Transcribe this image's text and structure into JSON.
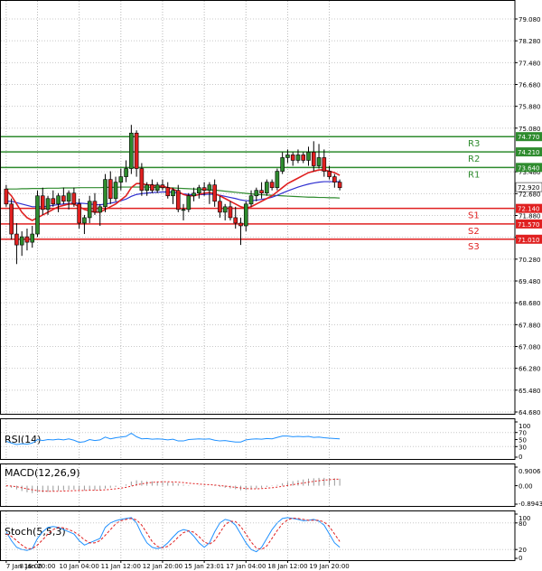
{
  "chart_data": {
    "type": "candlestick",
    "price_panel": {
      "ylim": [
        64.68,
        79.08
      ],
      "y_ticks": [
        "79.080",
        "78.280",
        "77.480",
        "76.680",
        "75.880",
        "75.080",
        "73.480",
        "72.680",
        "71.880",
        "71.080",
        "70.280",
        "69.480",
        "68.680",
        "67.880",
        "67.080",
        "66.280",
        "65.480",
        "64.680"
      ],
      "current_price": 72.92,
      "current_price_label": "72.920",
      "levels": [
        {
          "name": "R3",
          "value": 74.77,
          "label": "74.770",
          "color": "#2e8b2e"
        },
        {
          "name": "R2",
          "value": 74.21,
          "label": "74.210",
          "color": "#2e8b2e"
        },
        {
          "name": "R1",
          "value": 73.64,
          "label": "73.640",
          "color": "#2e8b2e"
        },
        {
          "name": "S1",
          "value": 72.14,
          "label": "72.140",
          "color": "#e02020"
        },
        {
          "name": "S2",
          "value": 71.57,
          "label": "71.570",
          "color": "#e02020"
        },
        {
          "name": "S3",
          "value": 71.01,
          "label": "71.010",
          "color": "#e02020"
        }
      ],
      "candles": [
        {
          "o": 72.85,
          "h": 73.0,
          "l": 72.2,
          "c": 72.3
        },
        {
          "o": 72.3,
          "h": 72.5,
          "l": 71.0,
          "c": 71.2
        },
        {
          "o": 71.2,
          "h": 71.6,
          "l": 70.1,
          "c": 70.8
        },
        {
          "o": 70.8,
          "h": 71.3,
          "l": 70.4,
          "c": 71.1
        },
        {
          "o": 71.1,
          "h": 71.4,
          "l": 70.6,
          "c": 70.9
        },
        {
          "o": 70.9,
          "h": 71.5,
          "l": 70.7,
          "c": 71.2
        },
        {
          "o": 71.2,
          "h": 72.8,
          "l": 71.1,
          "c": 72.6
        },
        {
          "o": 72.6,
          "h": 72.9,
          "l": 71.9,
          "c": 72.1
        },
        {
          "o": 72.1,
          "h": 72.6,
          "l": 71.9,
          "c": 72.5
        },
        {
          "o": 72.5,
          "h": 72.8,
          "l": 72.2,
          "c": 72.3
        },
        {
          "o": 72.3,
          "h": 72.7,
          "l": 72.0,
          "c": 72.6
        },
        {
          "o": 72.6,
          "h": 72.9,
          "l": 72.3,
          "c": 72.4
        },
        {
          "o": 72.4,
          "h": 72.8,
          "l": 72.1,
          "c": 72.7
        },
        {
          "o": 72.7,
          "h": 72.9,
          "l": 72.2,
          "c": 72.3
        },
        {
          "o": 72.3,
          "h": 72.5,
          "l": 71.4,
          "c": 71.6
        },
        {
          "o": 71.6,
          "h": 71.9,
          "l": 71.2,
          "c": 71.8
        },
        {
          "o": 71.8,
          "h": 72.6,
          "l": 71.6,
          "c": 72.4
        },
        {
          "o": 72.4,
          "h": 72.7,
          "l": 71.9,
          "c": 72.0
        },
        {
          "o": 72.0,
          "h": 72.3,
          "l": 71.5,
          "c": 72.2
        },
        {
          "o": 72.2,
          "h": 73.4,
          "l": 72.0,
          "c": 73.2
        },
        {
          "o": 73.2,
          "h": 73.5,
          "l": 72.3,
          "c": 72.5
        },
        {
          "o": 72.5,
          "h": 73.3,
          "l": 72.4,
          "c": 73.1
        },
        {
          "o": 73.1,
          "h": 73.6,
          "l": 72.8,
          "c": 73.3
        },
        {
          "o": 73.3,
          "h": 73.9,
          "l": 73.1,
          "c": 73.6
        },
        {
          "o": 73.6,
          "h": 75.2,
          "l": 73.4,
          "c": 74.9
        },
        {
          "o": 74.9,
          "h": 75.0,
          "l": 73.3,
          "c": 73.6
        },
        {
          "o": 73.6,
          "h": 73.8,
          "l": 72.6,
          "c": 72.8
        },
        {
          "o": 72.8,
          "h": 73.1,
          "l": 72.6,
          "c": 73.0
        },
        {
          "o": 73.0,
          "h": 73.2,
          "l": 72.7,
          "c": 72.8
        },
        {
          "o": 72.8,
          "h": 73.1,
          "l": 72.7,
          "c": 73.0
        },
        {
          "o": 73.0,
          "h": 73.2,
          "l": 72.8,
          "c": 72.9
        },
        {
          "o": 72.9,
          "h": 73.1,
          "l": 72.5,
          "c": 72.6
        },
        {
          "o": 72.6,
          "h": 72.9,
          "l": 72.3,
          "c": 72.8
        },
        {
          "o": 72.8,
          "h": 73.0,
          "l": 72.0,
          "c": 72.1
        },
        {
          "o": 72.1,
          "h": 72.3,
          "l": 71.7,
          "c": 72.1
        },
        {
          "o": 72.1,
          "h": 72.7,
          "l": 72.0,
          "c": 72.6
        },
        {
          "o": 72.6,
          "h": 72.9,
          "l": 72.4,
          "c": 72.7
        },
        {
          "o": 72.7,
          "h": 73.0,
          "l": 72.5,
          "c": 72.9
        },
        {
          "o": 72.9,
          "h": 73.1,
          "l": 72.6,
          "c": 72.8
        },
        {
          "o": 72.8,
          "h": 73.1,
          "l": 72.3,
          "c": 73.0
        },
        {
          "o": 73.0,
          "h": 73.2,
          "l": 72.2,
          "c": 72.4
        },
        {
          "o": 72.4,
          "h": 72.6,
          "l": 71.8,
          "c": 72.0
        },
        {
          "o": 72.0,
          "h": 72.3,
          "l": 71.7,
          "c": 72.2
        },
        {
          "o": 72.2,
          "h": 72.4,
          "l": 71.7,
          "c": 71.8
        },
        {
          "o": 71.8,
          "h": 72.2,
          "l": 71.4,
          "c": 71.6
        },
        {
          "o": 71.6,
          "h": 71.8,
          "l": 70.8,
          "c": 71.5
        },
        {
          "o": 71.5,
          "h": 72.4,
          "l": 71.3,
          "c": 72.3
        },
        {
          "o": 72.3,
          "h": 72.8,
          "l": 72.2,
          "c": 72.6
        },
        {
          "o": 72.6,
          "h": 72.9,
          "l": 72.4,
          "c": 72.8
        },
        {
          "o": 72.8,
          "h": 73.1,
          "l": 72.5,
          "c": 72.7
        },
        {
          "o": 72.7,
          "h": 73.2,
          "l": 72.6,
          "c": 73.1
        },
        {
          "o": 73.1,
          "h": 73.2,
          "l": 72.8,
          "c": 72.9
        },
        {
          "o": 72.9,
          "h": 73.6,
          "l": 72.8,
          "c": 73.5
        },
        {
          "o": 73.5,
          "h": 74.2,
          "l": 73.4,
          "c": 74.0
        },
        {
          "o": 74.0,
          "h": 74.3,
          "l": 73.8,
          "c": 74.1
        },
        {
          "o": 74.1,
          "h": 74.2,
          "l": 73.7,
          "c": 73.9
        },
        {
          "o": 73.9,
          "h": 74.3,
          "l": 73.8,
          "c": 74.1
        },
        {
          "o": 74.1,
          "h": 74.2,
          "l": 73.8,
          "c": 73.9
        },
        {
          "o": 73.9,
          "h": 74.4,
          "l": 73.7,
          "c": 74.2
        },
        {
          "o": 74.2,
          "h": 74.6,
          "l": 73.5,
          "c": 73.7
        },
        {
          "o": 73.7,
          "h": 74.5,
          "l": 73.6,
          "c": 74.0
        },
        {
          "o": 74.0,
          "h": 74.3,
          "l": 73.3,
          "c": 73.5
        },
        {
          "o": 73.5,
          "h": 73.7,
          "l": 73.2,
          "c": 73.3
        },
        {
          "o": 73.3,
          "h": 73.4,
          "l": 72.9,
          "c": 73.1
        },
        {
          "o": 73.1,
          "h": 73.2,
          "l": 72.8,
          "c": 72.9
        }
      ],
      "ma_fast": [
        72.8,
        72.6,
        72.3,
        72.0,
        71.8,
        71.7,
        71.8,
        71.9,
        72.0,
        72.1,
        72.2,
        72.25,
        72.3,
        72.3,
        72.2,
        72.1,
        72.05,
        72.0,
        72.0,
        72.1,
        72.2,
        72.3,
        72.45,
        72.6,
        72.9,
        73.05,
        73.05,
        73.0,
        73.0,
        72.95,
        72.95,
        72.9,
        72.85,
        72.75,
        72.65,
        72.6,
        72.6,
        72.65,
        72.7,
        72.72,
        72.68,
        72.6,
        72.5,
        72.4,
        72.3,
        72.2,
        72.15,
        72.2,
        72.3,
        72.4,
        72.5,
        72.6,
        72.75,
        72.9,
        73.05,
        73.15,
        73.25,
        73.35,
        73.45,
        73.5,
        73.55,
        73.55,
        73.5,
        73.45,
        73.35
      ],
      "ma_mid": [
        72.4,
        72.4,
        72.35,
        72.3,
        72.25,
        72.2,
        72.2,
        72.2,
        72.22,
        72.25,
        72.28,
        72.3,
        72.32,
        72.33,
        72.33,
        72.32,
        72.3,
        72.28,
        72.27,
        72.3,
        72.33,
        72.37,
        72.42,
        72.48,
        72.58,
        72.65,
        72.68,
        72.7,
        72.72,
        72.73,
        72.74,
        72.74,
        72.73,
        72.7,
        72.67,
        72.65,
        72.64,
        72.64,
        72.65,
        72.66,
        72.65,
        72.62,
        72.58,
        72.54,
        72.5,
        72.45,
        72.42,
        72.42,
        72.44,
        72.47,
        72.5,
        72.55,
        72.62,
        72.7,
        72.78,
        72.85,
        72.92,
        72.98,
        73.03,
        73.07,
        73.1,
        73.12,
        73.12,
        73.12,
        73.12
      ],
      "ma_slow": [
        72.85,
        72.85,
        72.85,
        72.86,
        72.86,
        72.87,
        72.87,
        72.87,
        72.88,
        72.88,
        72.88,
        72.89,
        72.89,
        72.89,
        72.9,
        72.9,
        72.9,
        72.9,
        72.9,
        72.91,
        72.91,
        72.91,
        72.92,
        72.92,
        72.92,
        72.92,
        72.92,
        72.92,
        72.91,
        72.91,
        72.9,
        72.9,
        72.89,
        72.88,
        72.87,
        72.86,
        72.85,
        72.84,
        72.83,
        72.82,
        72.81,
        72.79,
        72.77,
        72.75,
        72.73,
        72.71,
        72.69,
        72.67,
        72.65,
        72.64,
        72.63,
        72.62,
        72.61,
        72.6,
        72.59,
        72.58,
        72.57,
        72.56,
        72.55,
        72.55,
        72.54,
        72.54,
        72.53,
        72.53,
        72.52
      ]
    },
    "rsi_panel": {
      "title": "RSI(14)",
      "ylim": [
        0,
        100
      ],
      "y_ticks": [
        "100",
        "70",
        "50",
        "30",
        "0"
      ],
      "values": [
        45,
        40,
        36,
        38,
        37,
        40,
        50,
        47,
        50,
        49,
        51,
        49,
        52,
        48,
        42,
        44,
        50,
        47,
        49,
        57,
        52,
        55,
        57,
        59,
        68,
        58,
        52,
        53,
        51,
        52,
        51,
        49,
        51,
        46,
        46,
        50,
        51,
        52,
        51,
        52,
        48,
        46,
        47,
        45,
        43,
        43,
        49,
        51,
        52,
        51,
        53,
        52,
        56,
        60,
        60,
        58,
        59,
        58,
        59,
        56,
        57,
        55,
        54,
        53,
        52
      ]
    },
    "macd_panel": {
      "title": "MACD(12,26,9)",
      "ylim": [
        -0.8943,
        0.9006
      ],
      "y_ticks": [
        "0.9006",
        "0.00",
        "-0.8943"
      ],
      "histogram": [
        -0.05,
        -0.1,
        -0.18,
        -0.26,
        -0.32,
        -0.36,
        -0.34,
        -0.32,
        -0.3,
        -0.27,
        -0.24,
        -0.22,
        -0.2,
        -0.19,
        -0.21,
        -0.23,
        -0.22,
        -0.22,
        -0.21,
        -0.14,
        -0.1,
        -0.06,
        0.0,
        0.06,
        0.2,
        0.26,
        0.24,
        0.22,
        0.21,
        0.2,
        0.18,
        0.16,
        0.14,
        0.1,
        0.05,
        0.02,
        0.0,
        -0.01,
        -0.01,
        0.0,
        -0.02,
        -0.06,
        -0.1,
        -0.13,
        -0.17,
        -0.22,
        -0.22,
        -0.18,
        -0.14,
        -0.1,
        -0.06,
        -0.02,
        0.04,
        0.12,
        0.18,
        0.22,
        0.26,
        0.3,
        0.34,
        0.36,
        0.38,
        0.38,
        0.37,
        0.36,
        0.34
      ],
      "signal": [
        0.0,
        -0.02,
        -0.05,
        -0.1,
        -0.15,
        -0.2,
        -0.24,
        -0.26,
        -0.27,
        -0.27,
        -0.27,
        -0.26,
        -0.25,
        -0.24,
        -0.23,
        -0.23,
        -0.22,
        -0.22,
        -0.22,
        -0.2,
        -0.18,
        -0.15,
        -0.12,
        -0.08,
        -0.02,
        0.04,
        0.09,
        0.13,
        0.16,
        0.18,
        0.19,
        0.19,
        0.18,
        0.17,
        0.15,
        0.12,
        0.1,
        0.08,
        0.06,
        0.05,
        0.03,
        0.01,
        -0.02,
        -0.05,
        -0.08,
        -0.11,
        -0.14,
        -0.15,
        -0.15,
        -0.14,
        -0.12,
        -0.1,
        -0.07,
        -0.03,
        0.01,
        0.05,
        0.09,
        0.13,
        0.17,
        0.21,
        0.24,
        0.27,
        0.29,
        0.31,
        0.32
      ]
    },
    "stoch_panel": {
      "title": "Stoch(5,5,3)",
      "ylim": [
        0,
        100
      ],
      "y_ticks": [
        "100",
        "80",
        "20",
        "0"
      ],
      "k": [
        60,
        40,
        25,
        20,
        18,
        22,
        45,
        60,
        70,
        72,
        70,
        65,
        60,
        55,
        40,
        30,
        35,
        40,
        45,
        70,
        80,
        85,
        88,
        90,
        92,
        80,
        55,
        35,
        25,
        22,
        25,
        35,
        48,
        60,
        65,
        62,
        50,
        35,
        25,
        35,
        60,
        80,
        88,
        85,
        75,
        55,
        35,
        20,
        15,
        25,
        45,
        65,
        80,
        90,
        92,
        90,
        88,
        85,
        86,
        88,
        84,
        75,
        55,
        35,
        25
      ],
      "d": [
        55,
        50,
        40,
        30,
        22,
        22,
        30,
        42,
        55,
        65,
        70,
        69,
        65,
        60,
        52,
        42,
        35,
        35,
        40,
        52,
        65,
        78,
        85,
        88,
        90,
        87,
        75,
        57,
        38,
        27,
        24,
        27,
        36,
        48,
        58,
        62,
        59,
        49,
        37,
        32,
        40,
        58,
        76,
        84,
        83,
        72,
        55,
        37,
        23,
        20,
        28,
        45,
        63,
        78,
        87,
        91,
        90,
        88,
        86,
        86,
        86,
        82,
        72,
        55,
        38
      ]
    },
    "x_ticks": [
      {
        "index": 0,
        "label": "7 Jan 16:00"
      },
      {
        "index": 6,
        "label": "8 Jan 20:00"
      },
      {
        "index": 14,
        "label": "10 Jan 04:00"
      },
      {
        "index": 22,
        "label": "11 Jan 12:00"
      },
      {
        "index": 30,
        "label": "12 Jan 20:00"
      },
      {
        "index": 38,
        "label": "15 Jan 23:01"
      },
      {
        "index": 46,
        "label": "17 Jan 04:00"
      },
      {
        "index": 54,
        "label": "18 Jan 12:00"
      },
      {
        "index": 62,
        "label": "19 Jan 20:00"
      }
    ]
  },
  "colors": {
    "bull_candle": "#2e8b2e",
    "bear_candle": "#e02020",
    "ma_fast": "#e02020",
    "ma_mid": "#3030d0",
    "ma_slow": "#2e8b2e",
    "rsi_line": "#1e90ff",
    "macd_hist": "#999999",
    "macd_signal": "#e02020",
    "stoch_k": "#1e90ff",
    "stoch_d": "#e02020"
  }
}
